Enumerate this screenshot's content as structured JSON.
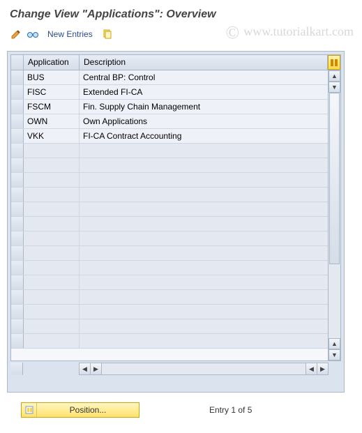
{
  "title": "Change View \"Applications\": Overview",
  "toolbar": {
    "new_entries": "New Entries"
  },
  "watermark": "www.tutorialkart.com",
  "table": {
    "columns": {
      "application": "Application",
      "description": "Description"
    },
    "rows": [
      {
        "app": "BUS",
        "desc": "Central BP: Control"
      },
      {
        "app": "FISC",
        "desc": "Extended FI-CA"
      },
      {
        "app": "FSCM",
        "desc": "Fin. Supply Chain Management"
      },
      {
        "app": "OWN",
        "desc": "Own Applications"
      },
      {
        "app": "VKK",
        "desc": "FI-CA Contract Accounting"
      }
    ],
    "empty_rows": 14
  },
  "footer": {
    "position_label": "Position...",
    "entry_text": "Entry 1 of 5"
  }
}
